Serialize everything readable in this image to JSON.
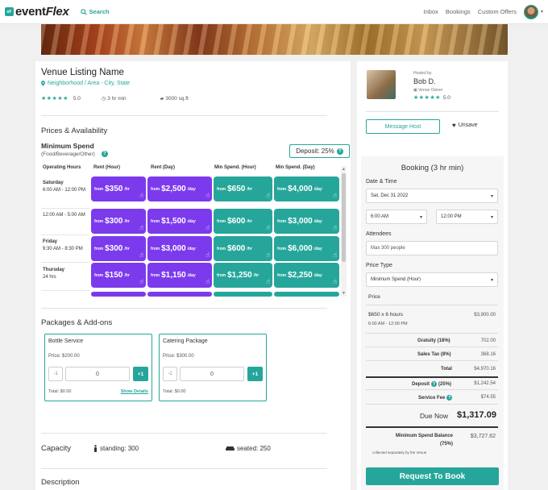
{
  "nav": {
    "logo_badge": "eF",
    "logo_text_1": "event",
    "logo_text_2": "Flex",
    "search_label": "Search",
    "links": [
      "Inbox",
      "Bookings",
      "Custom Offers"
    ]
  },
  "venue": {
    "title": "Venue Listing Name",
    "location": "Neighborhood / Area - City, State",
    "stars": "★★★★★",
    "rating": "5.0",
    "min_hours": "3 hr min",
    "size": "3000 sq.ft"
  },
  "pricing": {
    "section_title": "Prices & Availability",
    "min_spend_title": "Minimum Spend",
    "min_spend_sub": "(Food/Beverage/Other)",
    "deposit": "Deposit: 25%",
    "headers": [
      "Operating Hours",
      "Rent (Hour)",
      "Rent (Day)",
      "Min Spend. (Hour)",
      "Min Spend. (Day)"
    ],
    "from_text": "from",
    "per_hour": "/hr",
    "per_day": "/day",
    "rows": [
      {
        "day": "Saturday",
        "hours": "6:00 AM - 12:00 PM",
        "rent_hour": "$350",
        "rent_day": "$2,500",
        "min_hour": "$650",
        "min_day": "$4,000"
      },
      {
        "day": "",
        "hours": "12:00 AM - 5:00 AM",
        "rent_hour": "$300",
        "rent_day": "$1,500",
        "min_hour": "$600",
        "min_day": "$3,000"
      },
      {
        "day": "Friday",
        "hours": "9:30 AM - 8:30 PM",
        "rent_hour": "$300",
        "rent_day": "$3,000",
        "min_hour": "$600",
        "min_day": "$6,000"
      },
      {
        "day": "Thursday",
        "hours": "24 hrs",
        "rent_hour": "$150",
        "rent_day": "$1,150",
        "min_hour": "$1,250",
        "min_day": "$2,250"
      }
    ]
  },
  "packages": {
    "section_title": "Packages & Add-ons",
    "items": [
      {
        "name": "Bottle Service",
        "price": "Price: $200.00",
        "qty": "0",
        "minus": "-1",
        "plus": "+1",
        "total": "Total: $0.00",
        "details": "Show Details"
      },
      {
        "name": "Catering Package",
        "price": "Price: $300.00",
        "qty": "0",
        "minus": "-1",
        "plus": "+1",
        "total": "Total: $0.00",
        "details": ""
      }
    ]
  },
  "capacity": {
    "title": "Capacity",
    "standing": "standing: 300",
    "seated": "seated: 250"
  },
  "description": {
    "title": "Description"
  },
  "host": {
    "label": "Hosted by",
    "name": "Bob D.",
    "role": "Venue Owner",
    "stars": "★★★★★",
    "rating": "5.0",
    "message_btn": "Message Host",
    "unsave_btn": "Unsave"
  },
  "booking": {
    "title": "Booking (3 hr min)",
    "date_time_label": "Date & Time",
    "date": "Sat, Dec 31 2022",
    "start_time": "6:00 AM",
    "end_time": "12:00 PM",
    "attendees_label": "Attendees",
    "attendees_placeholder": "Max 300 people",
    "price_type_label": "Price Type",
    "price_type": "Minimum Spend (Hour)",
    "price_label": "Price",
    "price_line": "$650 x 6 hours",
    "price_line_val": "$3,900.00",
    "price_time": "6:00 AM - 12:00 PM",
    "gratuity_label": "Gratuity (18%)",
    "gratuity_val": "702.00",
    "tax_label": "Sales Tax (8%)",
    "tax_val": "368.16",
    "total_label": "Total",
    "total_val": "$4,970.16",
    "deposit_label": "Deposit",
    "deposit_pct": "(25%)",
    "deposit_val": "$1,242.54",
    "fee_label": "Service Fee",
    "fee_val": "$74.55",
    "due_label": "Due Now",
    "due_val": "$1,317.09",
    "balance_label": "Minimum Spend Balance",
    "balance_pct": "(75%)",
    "balance_val": "$3,727.62",
    "balance_note": "collected separately by the Venue",
    "book_btn": "Request To Book"
  }
}
